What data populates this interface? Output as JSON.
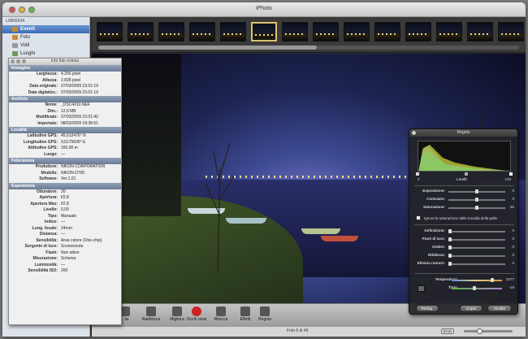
{
  "window": {
    "title": "iPhoto"
  },
  "sidebar": {
    "header": "LIBRERIA",
    "items": [
      {
        "label": "Eventi",
        "selected": true
      },
      {
        "label": "Foto"
      },
      {
        "label": "Volti"
      },
      {
        "label": "Luoghi"
      }
    ]
  },
  "filmstrip": {
    "thumb_count": 14,
    "selected_index": 5
  },
  "info_panel": {
    "title": "Info foto estesa",
    "sections": [
      {
        "title": "Immagine",
        "rows": [
          [
            "Larghezza:",
            "4.256 pixel"
          ],
          [
            "Altezza:",
            "2.828 pixel"
          ],
          [
            "Data originale:",
            "07/03/2009 23.01:19"
          ],
          [
            "Data digitalizz.:",
            "07/03/2009 23.01:19"
          ]
        ]
      },
      {
        "title": "Archivio",
        "rows": [
          [
            "Nome:",
            "_DSC4210.NEF"
          ],
          [
            "Dim.:",
            "12,6 MB"
          ],
          [
            "Modificato:",
            "07/03/2009 23.01:42"
          ],
          [
            "Importato:",
            "08/03/2009 18:38:51"
          ]
        ]
      },
      {
        "title": "Località",
        "rows": [
          [
            "Latitudine GPS:",
            "45,612476° N"
          ],
          [
            "Longitudine GPS:",
            "9,5175695° E"
          ],
          [
            "Altitudine GPS:",
            "160,00 m"
          ],
          [
            "Luogo:",
            "—"
          ]
        ]
      },
      {
        "title": "Fotocamera",
        "rows": [
          [
            "Produttore:",
            "NIKON CORPORATION"
          ],
          [
            "Modello:",
            "NIKON D700"
          ],
          [
            "Software:",
            "Ver.1.01"
          ]
        ]
      },
      {
        "title": "Esposizione",
        "rows": [
          [
            "Otturatore:",
            "20"
          ],
          [
            "Apertura:",
            "f/2.8"
          ],
          [
            "Apertura Max:",
            "f/2.8"
          ],
          [
            "Livello:",
            "0,00"
          ],
          [
            "Tipo:",
            "Manuale"
          ],
          [
            "Indice:",
            "—"
          ],
          [
            "Lung. focale:",
            "24mm"
          ],
          [
            "Distanza:",
            "—"
          ],
          [
            "Sensibilità:",
            "Area colore (One-chip)"
          ],
          [
            "Sorgente di luce:",
            "Sconosciuta"
          ],
          [
            "Flash:",
            "Non attivo"
          ],
          [
            "Misurazione:",
            "Schema"
          ],
          [
            "Luminosità:",
            "—"
          ],
          [
            "Sensibilità ISO:",
            "200"
          ]
        ]
      }
    ]
  },
  "toolbar": {
    "items": [
      {
        "label": "...lia",
        "icon": "rotate-icon"
      },
      {
        "label": "Raddrizza",
        "icon": "straighten-icon"
      },
      {
        "label": "Migliora",
        "icon": "enhance-wand-icon"
      },
      {
        "label": "Occhi rossi",
        "icon": "red-eye-icon"
      },
      {
        "label": "Ritocca",
        "icon": "retouch-brush-icon"
      },
      {
        "label": "Effetti",
        "icon": "effects-grid-icon"
      },
      {
        "label": "Regola",
        "icon": "adjust-icon"
      }
    ]
  },
  "status": {
    "counter": "Foto 6 di 49",
    "raw_badge": "RAW",
    "zoom_level": 0.3
  },
  "adjust_panel": {
    "title": "Regola",
    "levels_label": "Livelli",
    "levels_min": "0",
    "levels_max": "100",
    "sliders_top": [
      {
        "label": "Esposizione:",
        "value": "0",
        "pos": 0.5
      },
      {
        "label": "Contrasto:",
        "value": "0",
        "pos": 0.5
      },
      {
        "label": "Saturazione:",
        "value": "50",
        "pos": 0.5
      }
    ],
    "checkbox_label": "Ignora la saturazione delle tonalità della pelle",
    "checkbox_checked": false,
    "sliders_mid": [
      {
        "label": "Definizione:",
        "value": "0",
        "pos": 0.0
      },
      {
        "label": "Punti di luce:",
        "value": "0",
        "pos": 0.0
      },
      {
        "label": "Ombre:",
        "value": "0",
        "pos": 0.0
      },
      {
        "label": "Nitidezza:",
        "value": "0",
        "pos": 0.0
      },
      {
        "label": "Elimina rumore:",
        "value": "0",
        "pos": 0.0
      }
    ],
    "sliders_bottom": [
      {
        "label": "Temperatura:",
        "value": "3477",
        "pos": 0.82
      },
      {
        "label": "Tinta:",
        "value": "-18",
        "pos": 0.45
      }
    ],
    "buttons": {
      "reset": "Reimp.",
      "copy": "Copia",
      "paste": "Incolla"
    }
  }
}
